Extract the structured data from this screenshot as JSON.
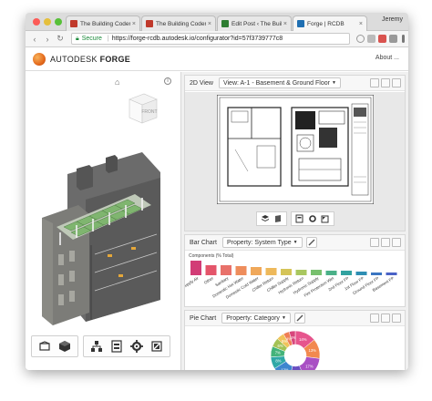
{
  "browser": {
    "tabs": [
      {
        "label": "The Building Coder:",
        "favicon_color": "#c0392b",
        "active": false
      },
      {
        "label": "The Building Coder:",
        "favicon_color": "#c0392b",
        "active": false
      },
      {
        "label": "Edit Post ‹ The Build",
        "favicon_color": "#2e7d32",
        "active": false
      },
      {
        "label": "Forge | RCDB",
        "favicon_color": "#1f6fb2",
        "active": true
      }
    ],
    "user_name": "Jeremy",
    "secure_label": "Secure",
    "url": "https://forge-rcdb.autodesk.io/configurator?id=57f3739777c8"
  },
  "app": {
    "brand_light": "AUTODESK",
    "brand_bold": "FORGE",
    "about": "About ..."
  },
  "viewer": {
    "cube_label": "FRONT",
    "toolbar_groups": [
      [
        "orbit-icon",
        "cube-icon"
      ],
      [
        "structure-icon",
        "properties-icon",
        "settings-icon",
        "fullscreen-icon"
      ]
    ]
  },
  "panels": {
    "view2d": {
      "title": "2D View",
      "dropdown": "View: A-1 - Basement & Ground Floor"
    },
    "bar": {
      "title": "Bar Chart",
      "dropdown": "Property: System Type",
      "components_label": "Components (% Total)"
    },
    "pie": {
      "title": "Pie Chart",
      "dropdown": "Property: Category"
    }
  },
  "chart_data": [
    {
      "type": "bar",
      "title": "Components (% Total)",
      "categories": [
        "Supply Air",
        "Other",
        "Sanitary",
        "Domestic Hot Water",
        "Domestic Cold Water",
        "Chiller Return",
        "Chiller Supply",
        "Hydronic Return",
        "Hydronic Supply",
        "Fire Protection Wet",
        "2nd Floor FP",
        "1st Floor FP",
        "Ground Floor FP",
        "Basement FP"
      ],
      "values": [
        16,
        11,
        11,
        10,
        9,
        8,
        7,
        6,
        6,
        5,
        5,
        4,
        3,
        3
      ],
      "colors": [
        "#d23c76",
        "#e4556a",
        "#e8716a",
        "#ee8d5c",
        "#f0a85a",
        "#eeb95b",
        "#d5c458",
        "#a9c760",
        "#78c06e",
        "#4ab088",
        "#32a2a0",
        "#2e8eb3",
        "#3a75c1",
        "#4a62c6"
      ]
    },
    {
      "type": "pie",
      "labels": [
        "14%",
        "13%",
        "17%",
        "10%",
        "12%",
        "8%",
        "7%",
        "6%",
        "5%",
        "4%",
        "4%"
      ],
      "values": [
        14,
        13,
        17,
        10,
        12,
        8,
        7,
        6,
        5,
        4,
        4
      ],
      "colors": [
        "#e6558d",
        "#f2894f",
        "#a950c4",
        "#6a4fc1",
        "#3d86cf",
        "#2fa8a7",
        "#43b37a",
        "#a4c255",
        "#f0c35a",
        "#ef7e55",
        "#d8467c"
      ]
    }
  ]
}
